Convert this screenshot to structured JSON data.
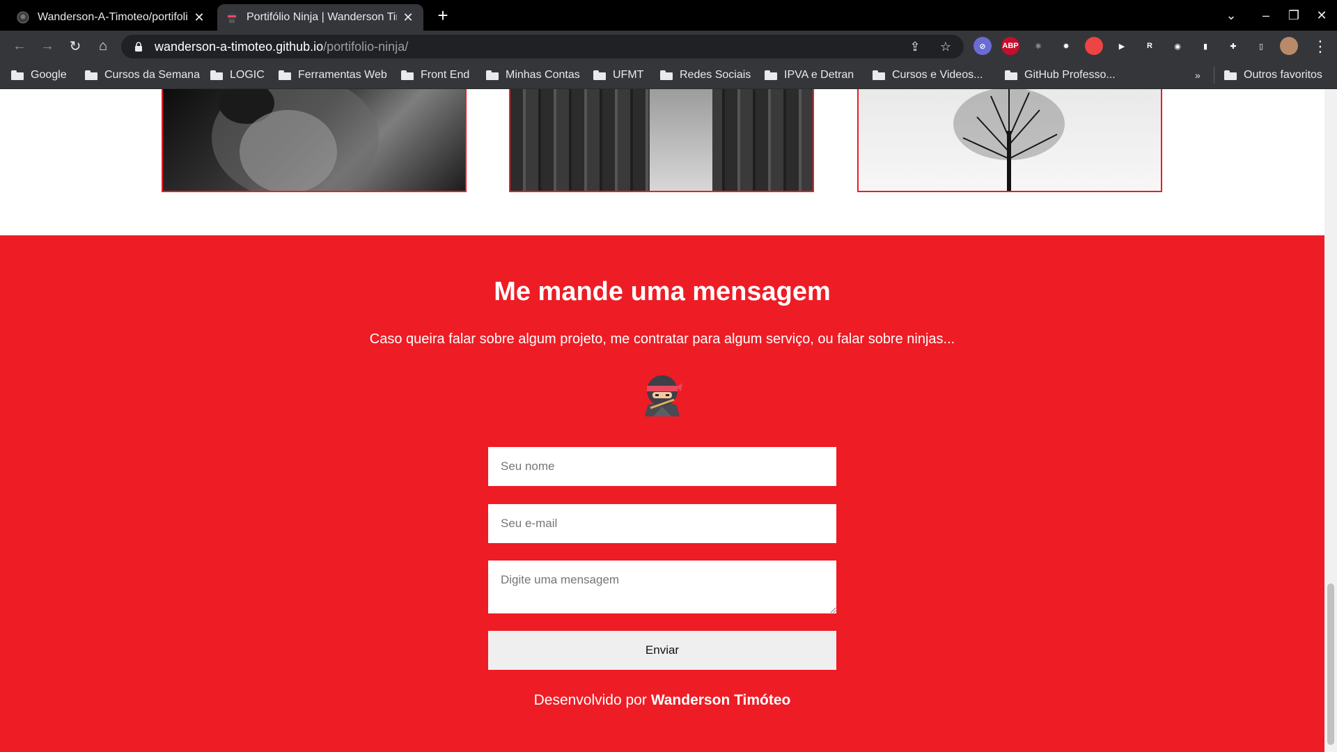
{
  "browser": {
    "tabs": [
      {
        "title": "Wanderson-A-Timoteo/portifolio-ninja",
        "active": false
      },
      {
        "title": "Portifólio Ninja | Wanderson Timóteo",
        "active": true
      }
    ],
    "url": {
      "host": "wanderson-a-timoteo.github.io",
      "path": "/portifolio-ninja/"
    },
    "bookmarks": [
      "Google",
      "Cursos da Semana",
      "LOGIC",
      "Ferramentas Web",
      "Front End",
      "Minhas Contas",
      "UFMT",
      "Redes Sociais",
      "IPVA e Detran",
      "Cursos e Videos...",
      "GitHub Professo..."
    ],
    "bookmarks_overflow": "»",
    "other_bookmarks": "Outros favoritos",
    "extensions": [
      {
        "name": "blocker-icon",
        "label": "⊘",
        "color": "#6b6bd6"
      },
      {
        "name": "adblock-plus-icon",
        "label": "ABP",
        "color": "#c70d2c"
      },
      {
        "name": "react-devtools-icon",
        "label": "⚛",
        "color": "#35363a"
      },
      {
        "name": "gear-extension-icon",
        "label": "✹",
        "color": "#35363a"
      },
      {
        "name": "colorpicker-icon",
        "label": "",
        "color": "#e44"
      },
      {
        "name": "screen-record-icon",
        "label": "▶",
        "color": "#35363a"
      },
      {
        "name": "rd-extension-icon",
        "label": "R",
        "color": "#35363a"
      },
      {
        "name": "circle-extension-icon",
        "label": "◉",
        "color": "#35363a"
      },
      {
        "name": "clipboard-extension-icon",
        "label": "▮",
        "color": "#35363a"
      },
      {
        "name": "puzzle-extensions-icon",
        "label": "✚",
        "color": "#35363a"
      },
      {
        "name": "sidepanel-icon",
        "label": "▯",
        "color": "#35363a"
      }
    ]
  },
  "page": {
    "contact": {
      "title": "Me mande uma mensagem",
      "subtitle": "Caso queira falar sobre algum projeto, me contratar para algum serviço, ou falar sobre ninjas...",
      "name_placeholder": "Seu nome",
      "email_placeholder": "Seu e-mail",
      "message_placeholder": "Digite uma mensagem",
      "send_label": "Enviar"
    },
    "footer": {
      "prefix": "Desenvolvido por",
      "author": "Wanderson Timóteo"
    }
  },
  "colors": {
    "brand_red": "#ee1c25"
  }
}
